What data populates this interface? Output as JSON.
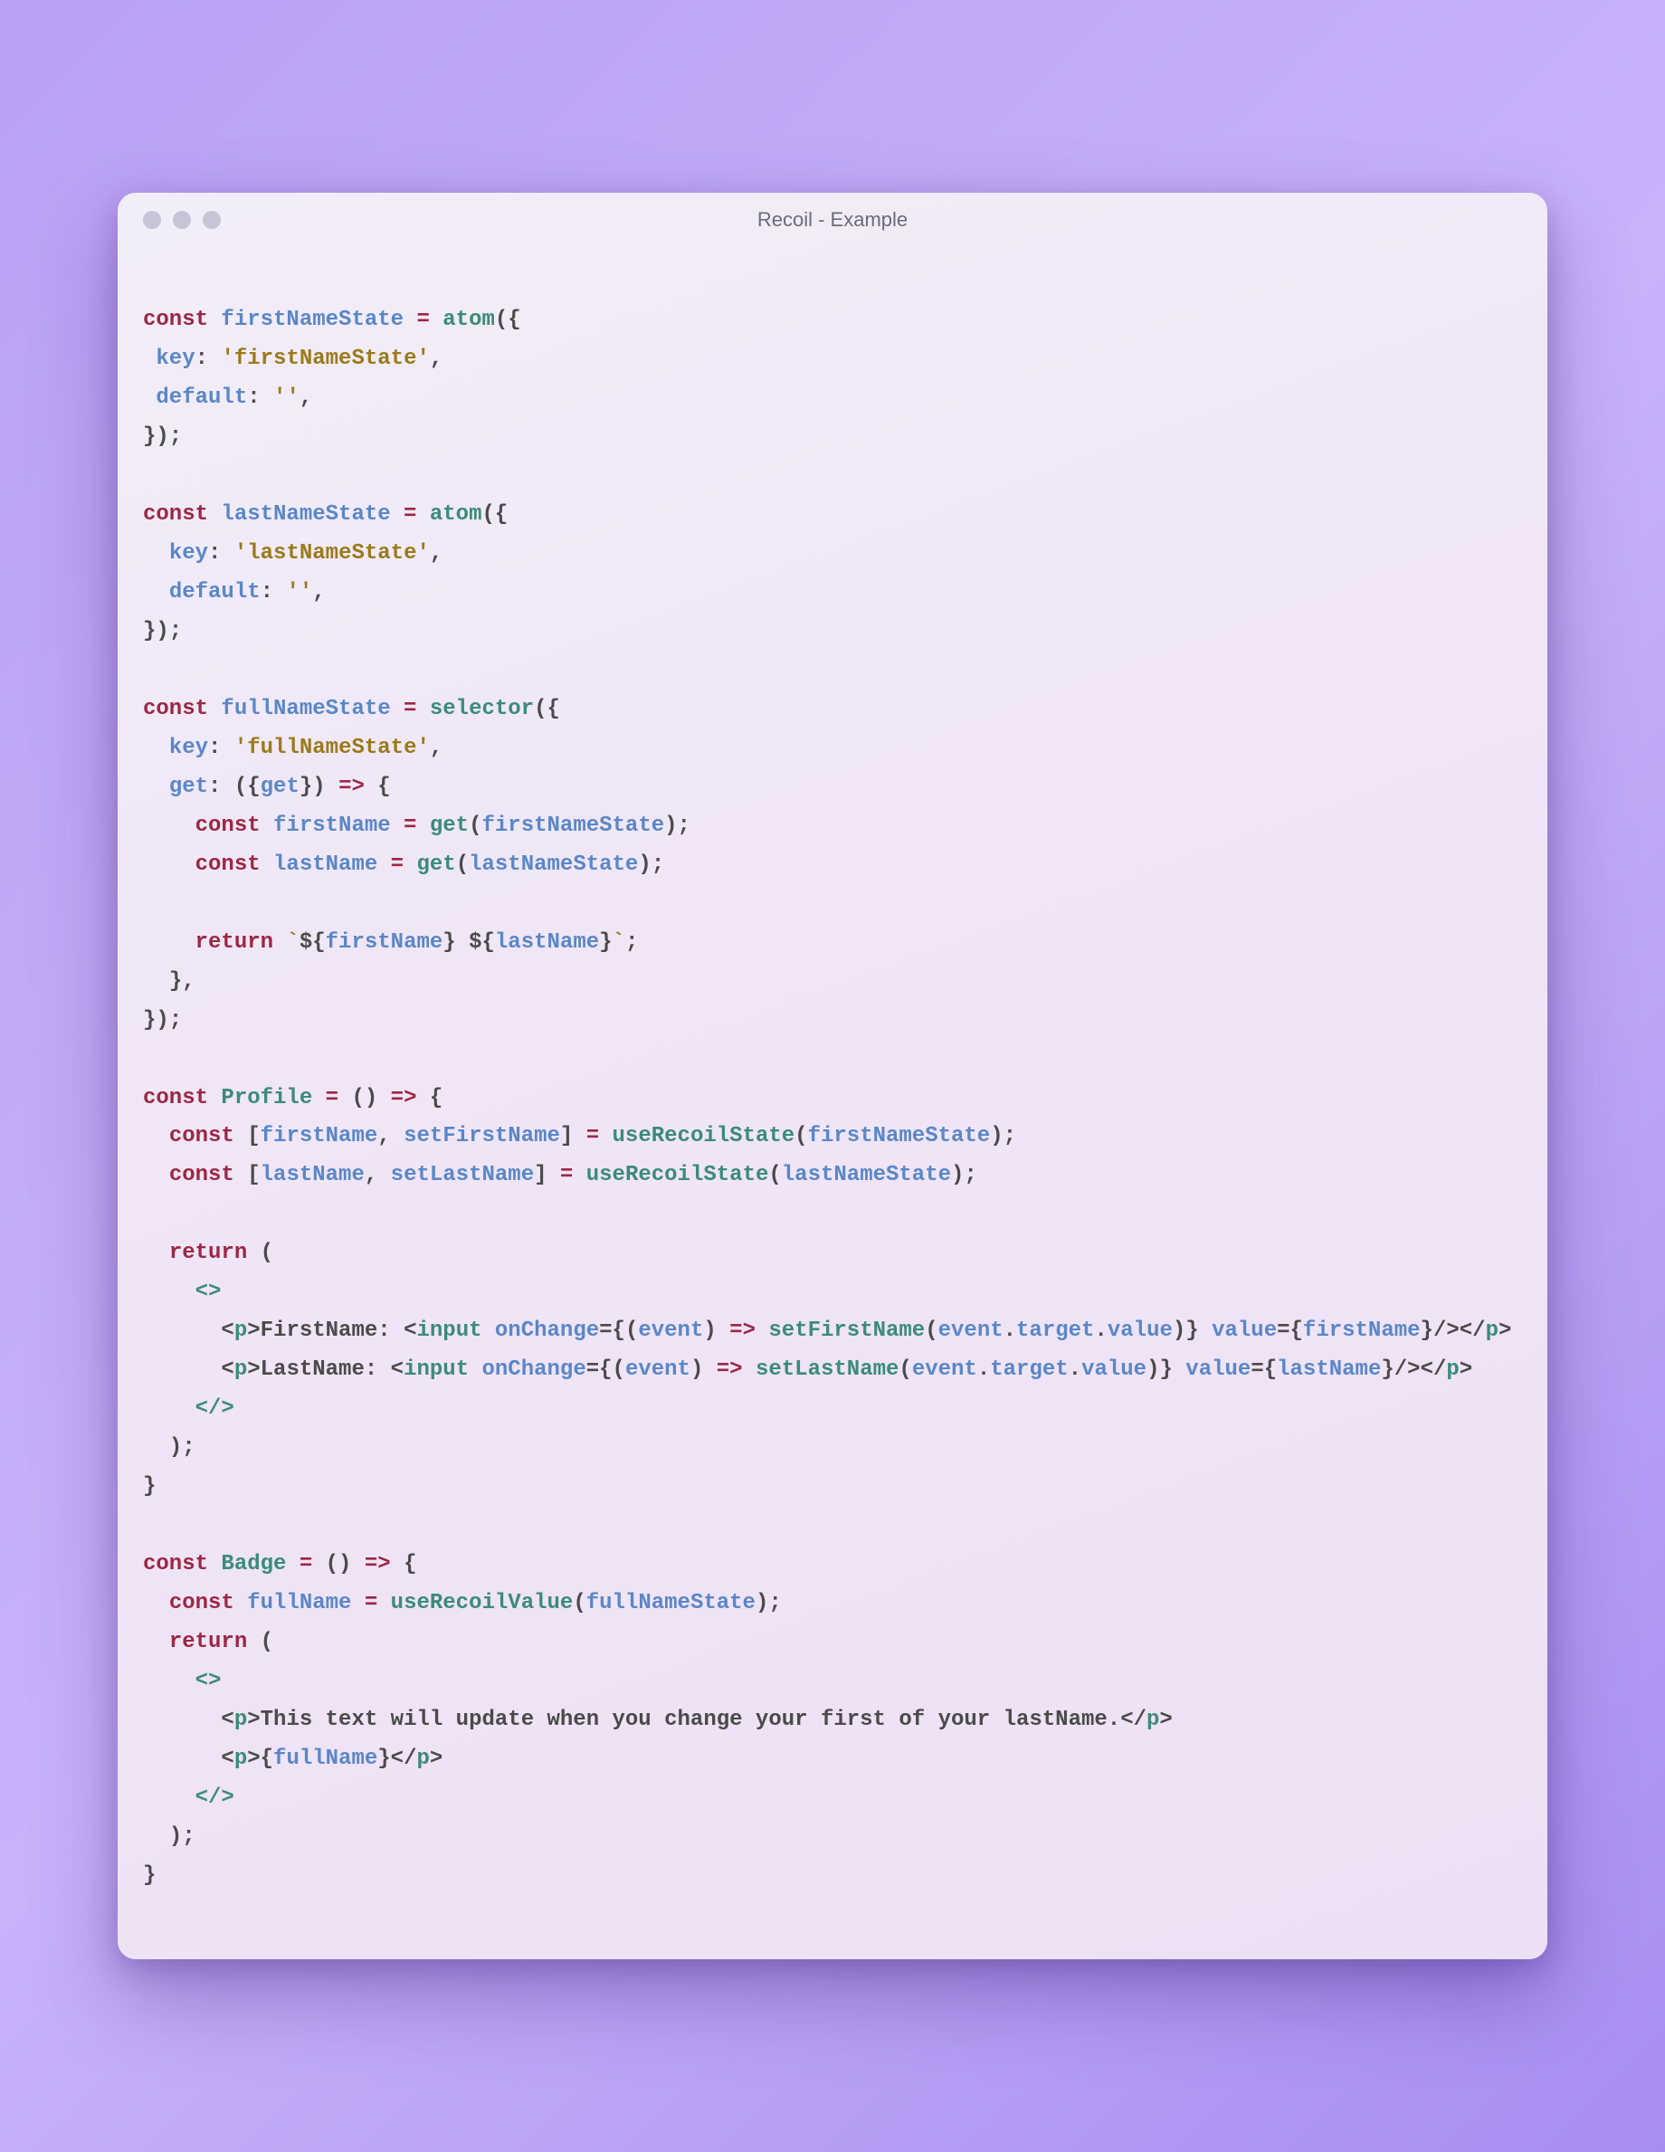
{
  "window": {
    "title": "Recoil - Example"
  },
  "code": {
    "kw_const": "const",
    "kw_return": "return",
    "id_firstNameState": "firstNameState",
    "id_lastNameState": "lastNameState",
    "id_fullNameState": "fullNameState",
    "id_firstName": "firstName",
    "id_lastName": "lastName",
    "id_fullName": "fullName",
    "id_setFirstName": "setFirstName",
    "id_setLastName": "setLastName",
    "id_Profile": "Profile",
    "id_Badge": "Badge",
    "id_event": "event",
    "id_target": "target",
    "id_value": "value",
    "fn_atom": "atom",
    "fn_selector": "selector",
    "fn_get": "get",
    "fn_useRecoilState": "useRecoilState",
    "fn_useRecoilValue": "useRecoilValue",
    "prop_key": "key",
    "prop_default": "default",
    "prop_get": "get",
    "str_firstNameState": "'firstNameState'",
    "str_lastNameState": "'lastNameState'",
    "str_fullNameState": "'fullNameState'",
    "str_empty": "''",
    "tag_p": "p",
    "tag_input": "input",
    "attr_onChange": "onChange",
    "attr_value": "value",
    "jsx_text_firstName": "FirstName: ",
    "jsx_text_lastName": "LastName: ",
    "jsx_text_badge": "This text will update when you change your first of your lastName.",
    "tmpl_space": " ",
    "pn_assign": " = ",
    "pn_lparen": "(",
    "pn_rparen": ")",
    "pn_lbrace": "{",
    "pn_rbrace": "}",
    "pn_lbracket": "[",
    "pn_rbracket": "]",
    "pn_obj_open": "({",
    "pn_obj_close": "});",
    "pn_arrow": " => ",
    "pn_colon_sp": ": ",
    "pn_comma": ",",
    "pn_comma_sp": ", ",
    "pn_semi": ";",
    "pn_rparen_semi": ");",
    "pn_dot": ".",
    "pn_lt": "<",
    "pn_gt": ">",
    "pn_ltsl": "</",
    "pn_slgt": "/>",
    "pn_frag_open": "<>",
    "pn_frag_close": "</>",
    "pn_jsx_expr_open": "={",
    "pn_jsx_expr_close": "}",
    "pn_backtick": "`",
    "pn_tlit_open": "${",
    "pn_tlit_close": "}",
    "pn_destr_open": "({",
    "pn_destr_close": "})",
    "pn_unit": "()",
    "pn_rparen_brace": ") {",
    "pn_close_comma": "},"
  }
}
